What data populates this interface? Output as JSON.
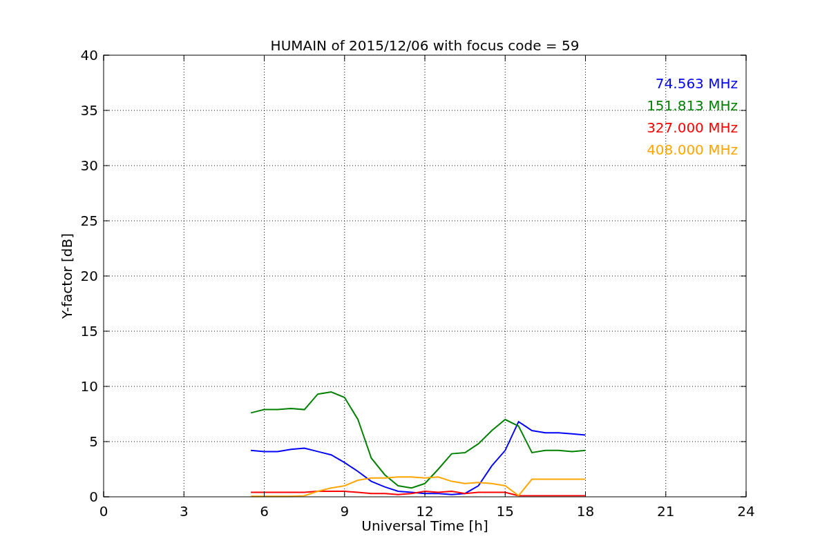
{
  "chart_data": {
    "type": "line",
    "title": "HUMAIN of 2015/12/06 with focus code = 59",
    "xlabel": "Universal Time [h]",
    "ylabel": "Y-factor [dB]",
    "x": [
      5.5,
      6,
      6.5,
      7,
      7.5,
      8,
      8.5,
      9,
      9.5,
      10,
      10.5,
      11,
      11.5,
      12,
      12.5,
      13,
      13.5,
      14,
      14.5,
      15,
      15.5,
      16,
      16.5,
      17,
      17.5,
      18
    ],
    "series": [
      {
        "name": "74.563 MHz",
        "color": "#0000ff",
        "values": [
          4.2,
          4.1,
          4.1,
          4.3,
          4.4,
          4.1,
          3.8,
          3.1,
          2.3,
          1.4,
          0.9,
          0.5,
          0.4,
          0.3,
          0.3,
          0.2,
          0.3,
          1.0,
          2.8,
          4.2,
          6.8,
          6.0,
          5.8,
          5.8,
          5.7,
          5.6
        ]
      },
      {
        "name": "151.813 MHz",
        "color": "#008000",
        "values": [
          7.6,
          7.9,
          7.9,
          8.0,
          7.9,
          9.3,
          9.5,
          9.0,
          7.0,
          3.5,
          2.0,
          1.0,
          0.8,
          1.2,
          2.5,
          3.9,
          4.0,
          4.8,
          6.0,
          7.0,
          6.4,
          4.0,
          4.2,
          4.2,
          4.1,
          4.2
        ]
      },
      {
        "name": "327.000 MHz",
        "color": "#ff0000",
        "values": [
          0.4,
          0.4,
          0.4,
          0.4,
          0.4,
          0.5,
          0.5,
          0.5,
          0.4,
          0.3,
          0.3,
          0.2,
          0.3,
          0.5,
          0.4,
          0.5,
          0.3,
          0.4,
          0.4,
          0.4,
          0.1,
          0.1,
          0.1,
          0.1,
          0.1,
          0.1
        ]
      },
      {
        "name": "408.000 MHz",
        "color": "#ffa500",
        "values": [
          0.05,
          0.05,
          0.05,
          0.05,
          0.1,
          0.5,
          0.8,
          1.0,
          1.5,
          1.7,
          1.7,
          1.8,
          1.8,
          1.7,
          1.8,
          1.4,
          1.2,
          1.3,
          1.2,
          1.0,
          0.1,
          1.6,
          1.6,
          1.6,
          1.6,
          1.6
        ]
      }
    ],
    "xlim": [
      0,
      24
    ],
    "ylim": [
      0,
      40
    ],
    "xticks": [
      0,
      3,
      6,
      9,
      12,
      15,
      18,
      21,
      24
    ],
    "yticks": [
      0,
      5,
      10,
      15,
      20,
      25,
      30,
      35,
      40
    ],
    "grid": true
  }
}
